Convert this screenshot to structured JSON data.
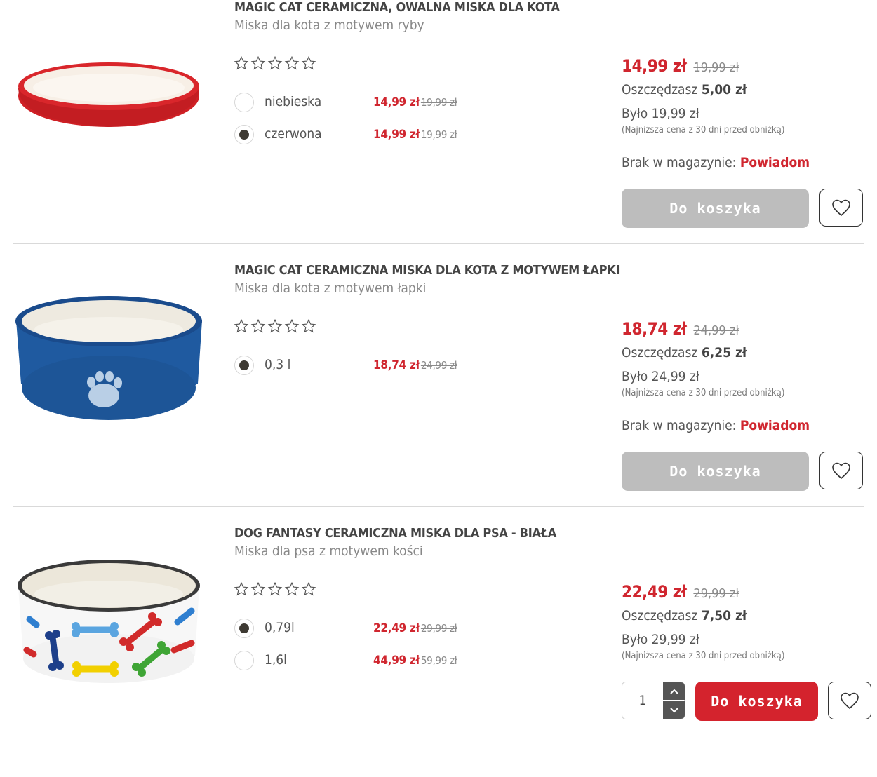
{
  "products": [
    {
      "title": "MAGIC CAT CERAMICZNA, OWALNA MISKA DLA KOTA",
      "subtitle": "Miska dla kota z motywem ryby",
      "image_icon": "oval-red-cat-bowl",
      "rating": 0,
      "variants": [
        {
          "label": "niebieska",
          "price": "14,99 zł",
          "old": "19,99 zł",
          "selected": false
        },
        {
          "label": "czerwona",
          "price": "14,99 zł",
          "old": "19,99 zł",
          "selected": true
        }
      ],
      "price": "14,99 zł",
      "old_price": "19,99 zł",
      "save_label": "Oszczędzasz",
      "save_amount": "5,00 zł",
      "was": "Było 19,99 zł",
      "lowest": "(Najniższa cena z 30 dni przed obniżką)",
      "stock_label": "Brak w magazynie:",
      "notify": "Powiadom",
      "cart": "Do koszyka",
      "cart_enabled": false
    },
    {
      "title": "MAGIC CAT CERAMICZNA MISKA DLA KOTA Z MOTYWEM ŁAPKI",
      "subtitle": "Miska dla kota z motywem łapki",
      "image_icon": "blue-paw-cat-bowl",
      "rating": 0,
      "variants": [
        {
          "label": "0,3 l",
          "price": "18,74 zł",
          "old": "24,99 zł",
          "selected": true
        }
      ],
      "price": "18,74 zł",
      "old_price": "24,99 zł",
      "save_label": "Oszczędzasz",
      "save_amount": "6,25 zł",
      "was": "Było 24,99 zł",
      "lowest": "(Najniższa cena z 30 dni przed obniżką)",
      "stock_label": "Brak w magazynie:",
      "notify": "Powiadom",
      "cart": "Do koszyka",
      "cart_enabled": false
    },
    {
      "title": "DOG FANTASY CERAMICZNA MISKA DLA PSA - BIAŁA",
      "subtitle": "Miska dla psa z motywem kości",
      "image_icon": "white-bones-dog-bowl",
      "rating": 0,
      "variants": [
        {
          "label": "0,79l",
          "price": "22,49 zł",
          "old": "29,99 zł",
          "selected": true
        },
        {
          "label": "1,6l",
          "price": "44,99 zł",
          "old": "59,99 zł",
          "selected": false
        }
      ],
      "price": "22,49 zł",
      "old_price": "29,99 zł",
      "save_label": "Oszczędzasz",
      "save_amount": "7,50 zł",
      "was": "Było 29,99 zł",
      "lowest": "(Najniższa cena z 30 dni przed obniżką)",
      "quantity": "1",
      "cart": "Do koszyka",
      "cart_enabled": true
    }
  ],
  "colors": {
    "accent": "#d4232d",
    "disabled": "#bdbdbd",
    "text": "#444444",
    "muted": "#888888"
  },
  "icons": {
    "star": "star-outline-icon",
    "wishlist": "heart-outline-icon",
    "qty_up": "chevron-up-icon",
    "qty_down": "chevron-down-icon"
  }
}
